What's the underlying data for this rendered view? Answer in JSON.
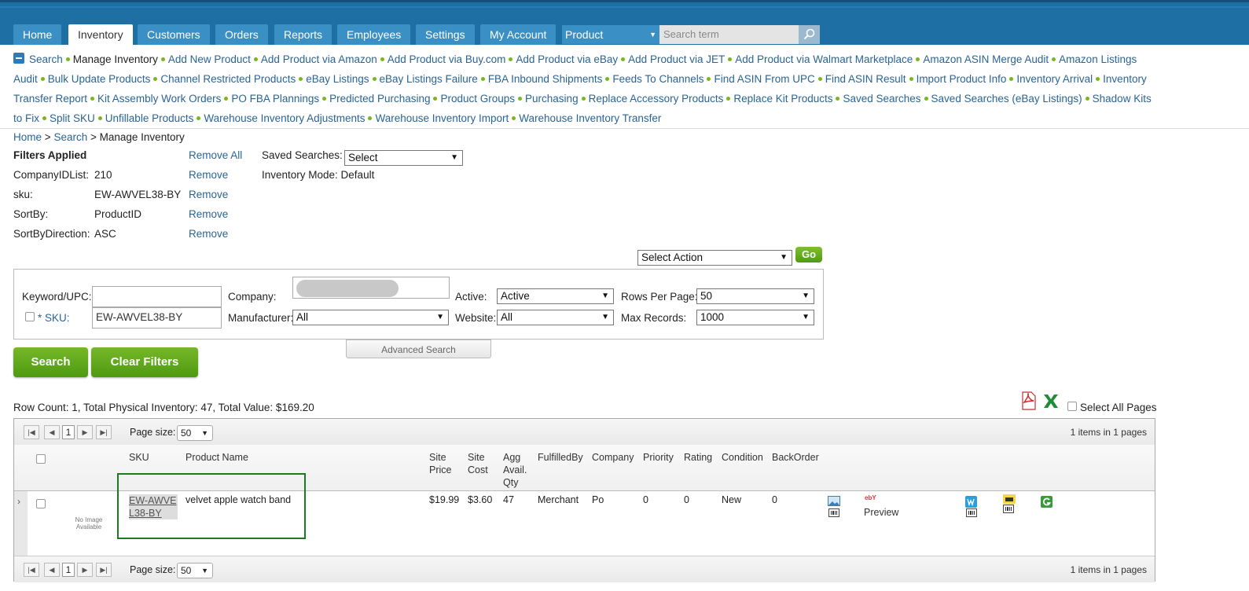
{
  "nav": {
    "tabs": [
      {
        "label": "Home"
      },
      {
        "label": "Inventory"
      },
      {
        "label": "Customers"
      },
      {
        "label": "Orders"
      },
      {
        "label": "Reports"
      },
      {
        "label": "Employees"
      },
      {
        "label": "Settings"
      },
      {
        "label": "My Account"
      }
    ],
    "search_type": "Product",
    "search_placeholder": "Search term"
  },
  "submenu": {
    "items": [
      "Search",
      "Manage Inventory",
      "Add New Product",
      "Add Product via Amazon",
      "Add Product via Buy.com",
      "Add Product via eBay",
      "Add Product via JET",
      "Add Product via Walmart Marketplace",
      "Amazon ASIN Merge Audit",
      "Amazon Listings Audit",
      "Bulk Update Products",
      "Channel Restricted Products",
      "eBay Listings",
      "eBay Listings Failure",
      "FBA Inbound Shipments",
      "Feeds To Channels",
      "Find ASIN From UPC",
      "Find ASIN Result",
      "Import Product Info",
      "Inventory Arrival",
      "Inventory Transfer Report",
      "Kit Assembly Work Orders",
      "PO FBA Plannings",
      "Predicted Purchasing",
      "Product Groups",
      "Purchasing",
      "Replace Accessory Products",
      "Replace Kit Products",
      "Saved Searches",
      "Saved Searches (eBay Listings)",
      "Shadow Kits to Fix",
      "Split SKU",
      "Unfillable Products",
      "Warehouse Inventory Adjustments",
      "Warehouse Inventory Import",
      "Warehouse Inventory Transfer"
    ],
    "current": "Manage Inventory"
  },
  "breadcrumb": {
    "home": "Home",
    "search": "Search",
    "current": "Manage Inventory",
    "sep": ">"
  },
  "filters": {
    "title": "Filters Applied",
    "remove_all": "Remove All",
    "remove": "Remove",
    "rows": [
      {
        "key": "CompanyIDList:",
        "value": "210"
      },
      {
        "key": "sku:",
        "value": "EW-AWVEL38-BY"
      },
      {
        "key": "SortBy:",
        "value": "ProductID"
      },
      {
        "key": "SortByDirection:",
        "value": "ASC"
      }
    ],
    "saved_searches_label": "Saved Searches:",
    "saved_searches_value": "Select",
    "inventory_mode": "Inventory Mode: Default"
  },
  "actions": {
    "select_action": "Select Action",
    "go": "Go"
  },
  "search_panel": {
    "keyword_label": "Keyword/UPC:",
    "keyword_value": "",
    "sku_label": "* SKU:",
    "sku_value": "EW-AWVEL38-BY",
    "company_label": "Company:",
    "manufacturer_label": "Manufacturer:",
    "manufacturer_value": "All",
    "active_label": "Active:",
    "active_value": "Active",
    "website_label": "Website:",
    "website_value": "All",
    "rows_per_page_label": "Rows Per Page:",
    "rows_per_page_value": "50",
    "max_records_label": "Max Records:",
    "max_records_value": "1000",
    "advanced": "Advanced Search",
    "search_btn": "Search",
    "clear_btn": "Clear Filters"
  },
  "summary": {
    "text": "Row Count: 1, Total Physical Inventory: 47, Total Value: $169.20",
    "select_all_pages": "Select All Pages"
  },
  "grid": {
    "page": "1",
    "page_size_label": "Page size:",
    "page_size": "50",
    "items_info": "1 items in 1 pages",
    "headers": {
      "sku": "SKU",
      "name": "Product Name",
      "site_price": "Site Price",
      "site_cost": "Site Cost",
      "agg_qty": "Agg Avail. Qty",
      "fulfilled_by": "FulfilledBy",
      "company": "Company",
      "priority": "Priority",
      "rating": "Rating",
      "condition": "Condition",
      "backorder": "BackOrder"
    },
    "row": {
      "no_image": "No Image Available",
      "sku": "EW-AWVEL38-BY",
      "name": "velvet apple watch band",
      "site_price": "$19.99",
      "site_cost": "$3.60",
      "agg_qty": "47",
      "fulfilled_by": "Merchant",
      "company": "Po",
      "priority": "0",
      "rating": "0",
      "condition": "New",
      "backorder": "0",
      "preview": "Preview",
      "ebay_badge": "ebY"
    }
  },
  "colors": {
    "nav_bg": "#1e6fa4",
    "tab_bg": "#3a8fc4",
    "green": "#5fa81a",
    "link": "#2a6496",
    "highlight": "#1e7a1e"
  }
}
